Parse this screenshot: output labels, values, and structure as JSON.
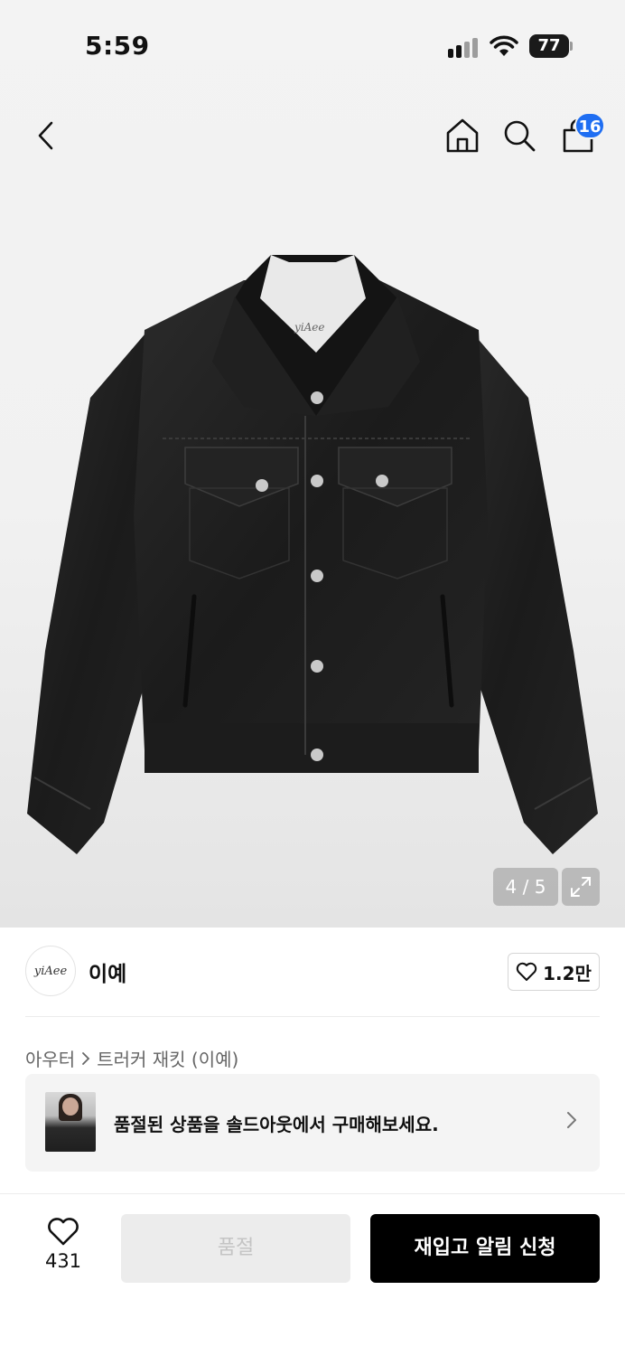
{
  "status_bar": {
    "time": "5:59",
    "battery": "77"
  },
  "nav": {
    "cart_count": "16"
  },
  "gallery": {
    "counter": "4 / 5",
    "label_tag": "yiAee"
  },
  "brand": {
    "logo_text": "yiAee",
    "name": "이예",
    "likes": "1.2만"
  },
  "breadcrumb": {
    "category": "아우터",
    "product": "트러커 재킷 (이예)"
  },
  "soldout_banner": {
    "text": "품절된 상품을 솔드아웃에서 구매해보세요."
  },
  "bottom_bar": {
    "wish_count": "431",
    "soldout_label": "품절",
    "restock_label": "재입고 알림 신청"
  }
}
